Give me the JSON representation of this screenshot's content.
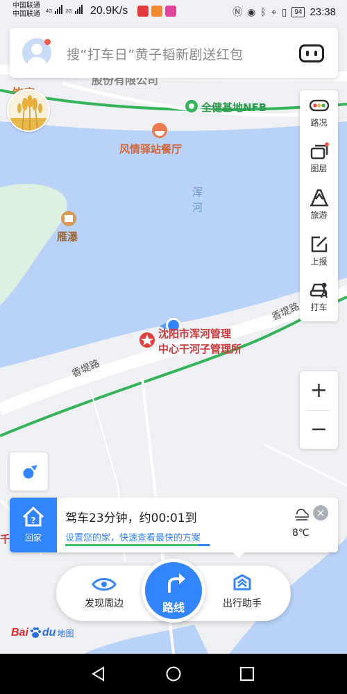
{
  "status_bar": {
    "carrier1": "中国联通",
    "carrier2": "中国联通",
    "net1": "4G",
    "net2": "2G",
    "speed": "20.9K/s",
    "battery": "94",
    "time": "23:38"
  },
  "search": {
    "placeholder": "搜“打车日”黄子韬新剧送红包"
  },
  "map_labels": {
    "base_station": "全健基地NFB",
    "restaurant": "风情驿站餐厅",
    "river_1": "浑",
    "river_2": "河",
    "poi_left": "雁瀑",
    "road_left": "香堤路",
    "road_right": "香堤路",
    "office_line1": "沈阳市浑河管理",
    "office_line2": "中心干河子管理所",
    "partial_top1": "股份有限公司",
    "partial_top2": "饮店",
    "partial_left": "千"
  },
  "toolbar": {
    "traffic": "路况",
    "layers": "图层",
    "travel": "旅游",
    "report": "上报",
    "taxi": "打车"
  },
  "zoom": {
    "in": "+",
    "out": "−"
  },
  "home_card": {
    "tile_label": "回家",
    "main": "驾车23分钟，约00:01到",
    "sub": "设置您的家，快速查看最快的方案",
    "temp": "8℃",
    "progress": 0.92
  },
  "bottom_bar": {
    "discover": "发现周边",
    "route": "路线",
    "assistant": "出行助手"
  },
  "logo": {
    "bai": "Bai",
    "du": "du",
    "ditu": "地图"
  },
  "colors": {
    "accent": "#3385ff",
    "water": "#b8d2f8",
    "road_green": "#35b35a",
    "poi_red": "#e0403a"
  }
}
